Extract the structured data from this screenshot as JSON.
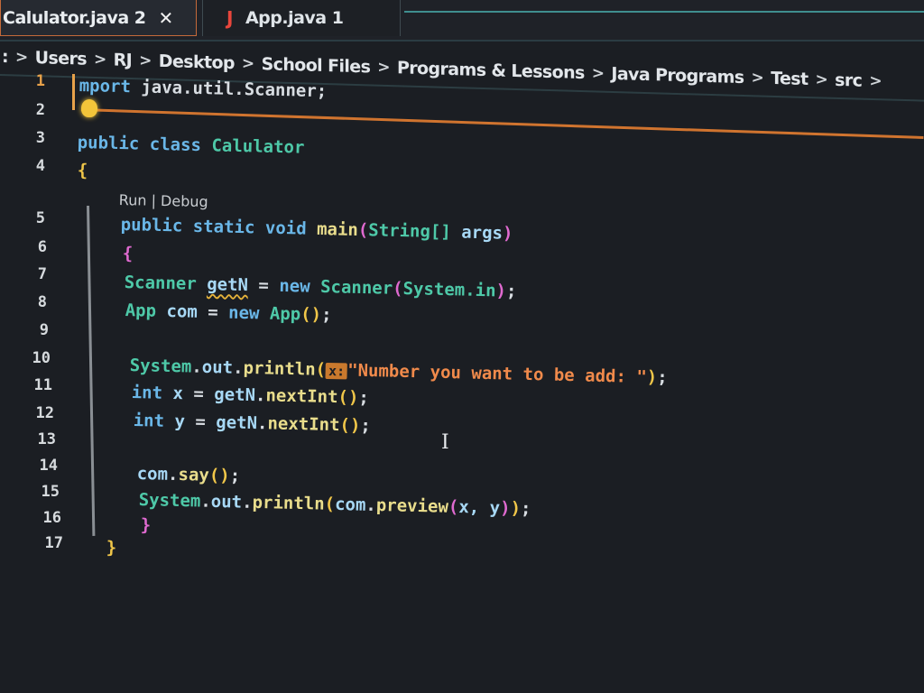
{
  "tabs": [
    {
      "label": "Calulator.java 2",
      "close": "✕",
      "active": true
    },
    {
      "label": "App.java 1",
      "icon": "java-icon",
      "icon_glyph": "J",
      "active": false
    }
  ],
  "breadcrumb": {
    "items": [
      ":",
      "Users",
      "RJ",
      "Desktop",
      "School Files",
      "Programs & Lessons",
      "Java Programs",
      "Test",
      "src"
    ],
    "separator": ">"
  },
  "codelens": {
    "run": "Run",
    "divider": " | ",
    "debug": "Debug"
  },
  "line_numbers": [
    "1",
    "2",
    "3",
    "4",
    "5",
    "6",
    "7",
    "8",
    "9",
    "10",
    "11",
    "12",
    "13",
    "14",
    "15",
    "16",
    "17"
  ],
  "code": {
    "line1": {
      "prefix": "mport",
      "rest": " java.util.Scanner",
      "end": ";"
    },
    "line3": {
      "kw1": "public",
      "kw2": "class",
      "name": "Calulator"
    },
    "line4": "{",
    "line5": {
      "kw1": "public",
      "kw2": "static",
      "kw3": "void",
      "fn": "main",
      "open": "(",
      "type": "String[]",
      "arg": "args",
      "close": ")"
    },
    "line6": "{",
    "line7": {
      "type": "Scanner",
      "var": "getN",
      "eq": " = ",
      "kw": "new",
      "ctor": "Scanner",
      "open": "(",
      "arg": "System.in",
      "close": ")",
      "end": ";"
    },
    "line8": {
      "type": "App",
      "var": "com",
      "eq": " = ",
      "kw": "new",
      "ctor": "App",
      "parens": "()",
      "end": ";"
    },
    "line10": {
      "obj": "System",
      "dot1": ".",
      "field": "out",
      "dot2": ".",
      "fn": "println",
      "open": "(",
      "hint": "x:",
      "str": "\"Number you want to be add: \"",
      "close": ")",
      "end": ";"
    },
    "line11": {
      "kw": "int",
      "var": "x",
      "eq": " = ",
      "obj": "getN",
      "dot": ".",
      "fn": "nextInt",
      "parens": "()",
      "end": ";"
    },
    "line12": {
      "kw": "int",
      "var": "y",
      "eq": " = ",
      "obj": "getN",
      "dot": ".",
      "fn": "nextInt",
      "parens": "()",
      "end": ";"
    },
    "line14": {
      "obj": "com",
      "dot": ".",
      "fn": "say",
      "parens": "()",
      "end": ";"
    },
    "line15": {
      "obj": "System",
      "dot1": ".",
      "field": "out",
      "dot2": ".",
      "fn": "println",
      "open": "(",
      "obj2": "com",
      "dot3": ".",
      "fn2": "preview",
      "open2": "(",
      "args": "x, y",
      "close2": ")",
      "close": ")",
      "end": ";"
    },
    "line16": "}",
    "line17": "}"
  },
  "cursor_glyph": "I",
  "colors": {
    "keyword": "#6ab7e8",
    "type": "#4ec9a8",
    "function": "#e9dd8c",
    "string": "#f08a4b",
    "brace": "#f0c649",
    "active_tab_border": "#c46a3a"
  }
}
